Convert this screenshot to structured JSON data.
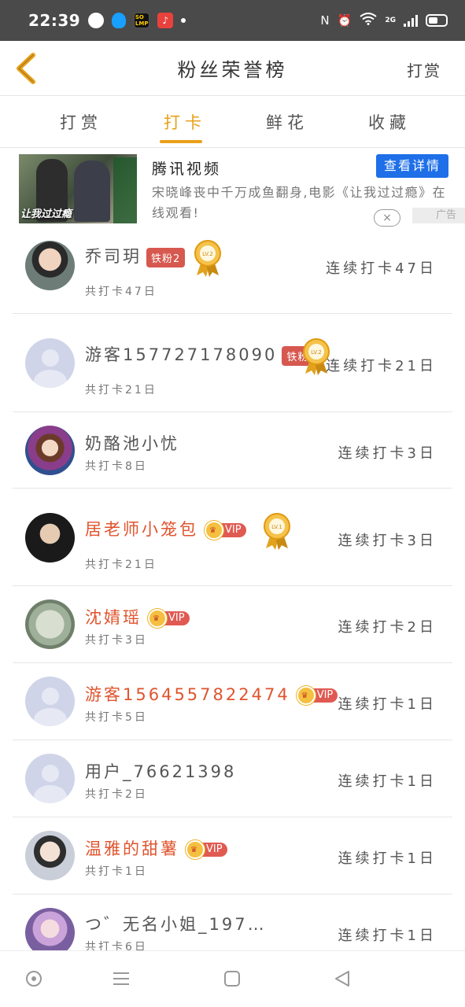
{
  "status_bar": {
    "time": "22:39",
    "network": "2G"
  },
  "header": {
    "title": "粉丝荣誉榜",
    "right_action": "打赏"
  },
  "tabs": [
    {
      "label": "打赏"
    },
    {
      "label": "打卡"
    },
    {
      "label": "鲜花"
    },
    {
      "label": "收藏"
    }
  ],
  "active_tab": "打卡",
  "ad": {
    "thumb_caption": "让我过过瘾",
    "source": "腾讯视频",
    "button": "查看详情",
    "description": "宋晓峰丧中千万成鱼翻身,电影《让我过过瘾》在线观看!",
    "close": "×",
    "label": "广告"
  },
  "rows": [
    {
      "name": "乔司玥",
      "badge": "铁粉2",
      "vip": false,
      "total": "共打卡47日",
      "streak": "连续打卡47日",
      "medal": "LV.2"
    },
    {
      "name": "游客157727178090",
      "badge": "铁粉1",
      "vip": false,
      "total": "共打卡21日",
      "streak": "连续打卡21日",
      "medal": "LV.2"
    },
    {
      "name": "奶酪池小忧",
      "badge": "",
      "vip": false,
      "total": "共打卡8日",
      "streak": "连续打卡3日",
      "medal": ""
    },
    {
      "name": "居老师小笼包",
      "badge": "",
      "vip": true,
      "total": "共打卡21日",
      "streak": "连续打卡3日",
      "medal": "LV.1"
    },
    {
      "name": "沈婧瑶",
      "badge": "",
      "vip": true,
      "total": "共打卡3日",
      "streak": "连续打卡2日",
      "medal": ""
    },
    {
      "name": "游客1564557822474",
      "badge": "",
      "vip": true,
      "total": "共打卡5日",
      "streak": "连续打卡1日",
      "medal": ""
    },
    {
      "name": "用户_76621398",
      "badge": "",
      "vip": false,
      "total": "共打卡2日",
      "streak": "连续打卡1日",
      "medal": ""
    },
    {
      "name": "温雅的甜薯",
      "badge": "",
      "vip": true,
      "total": "共打卡1日",
      "streak": "连续打卡1日",
      "medal": ""
    },
    {
      "name": "つ゛无名小姐_197…",
      "badge": "",
      "vip": false,
      "total": "共打卡6日",
      "streak": "连续打卡1日",
      "medal": ""
    }
  ],
  "vip_label": "VIP",
  "colors": {
    "accent": "#e9a019",
    "vip_name": "#e0542e",
    "fan_badge": "#d6584f",
    "ad_button": "#1e6fe8"
  }
}
